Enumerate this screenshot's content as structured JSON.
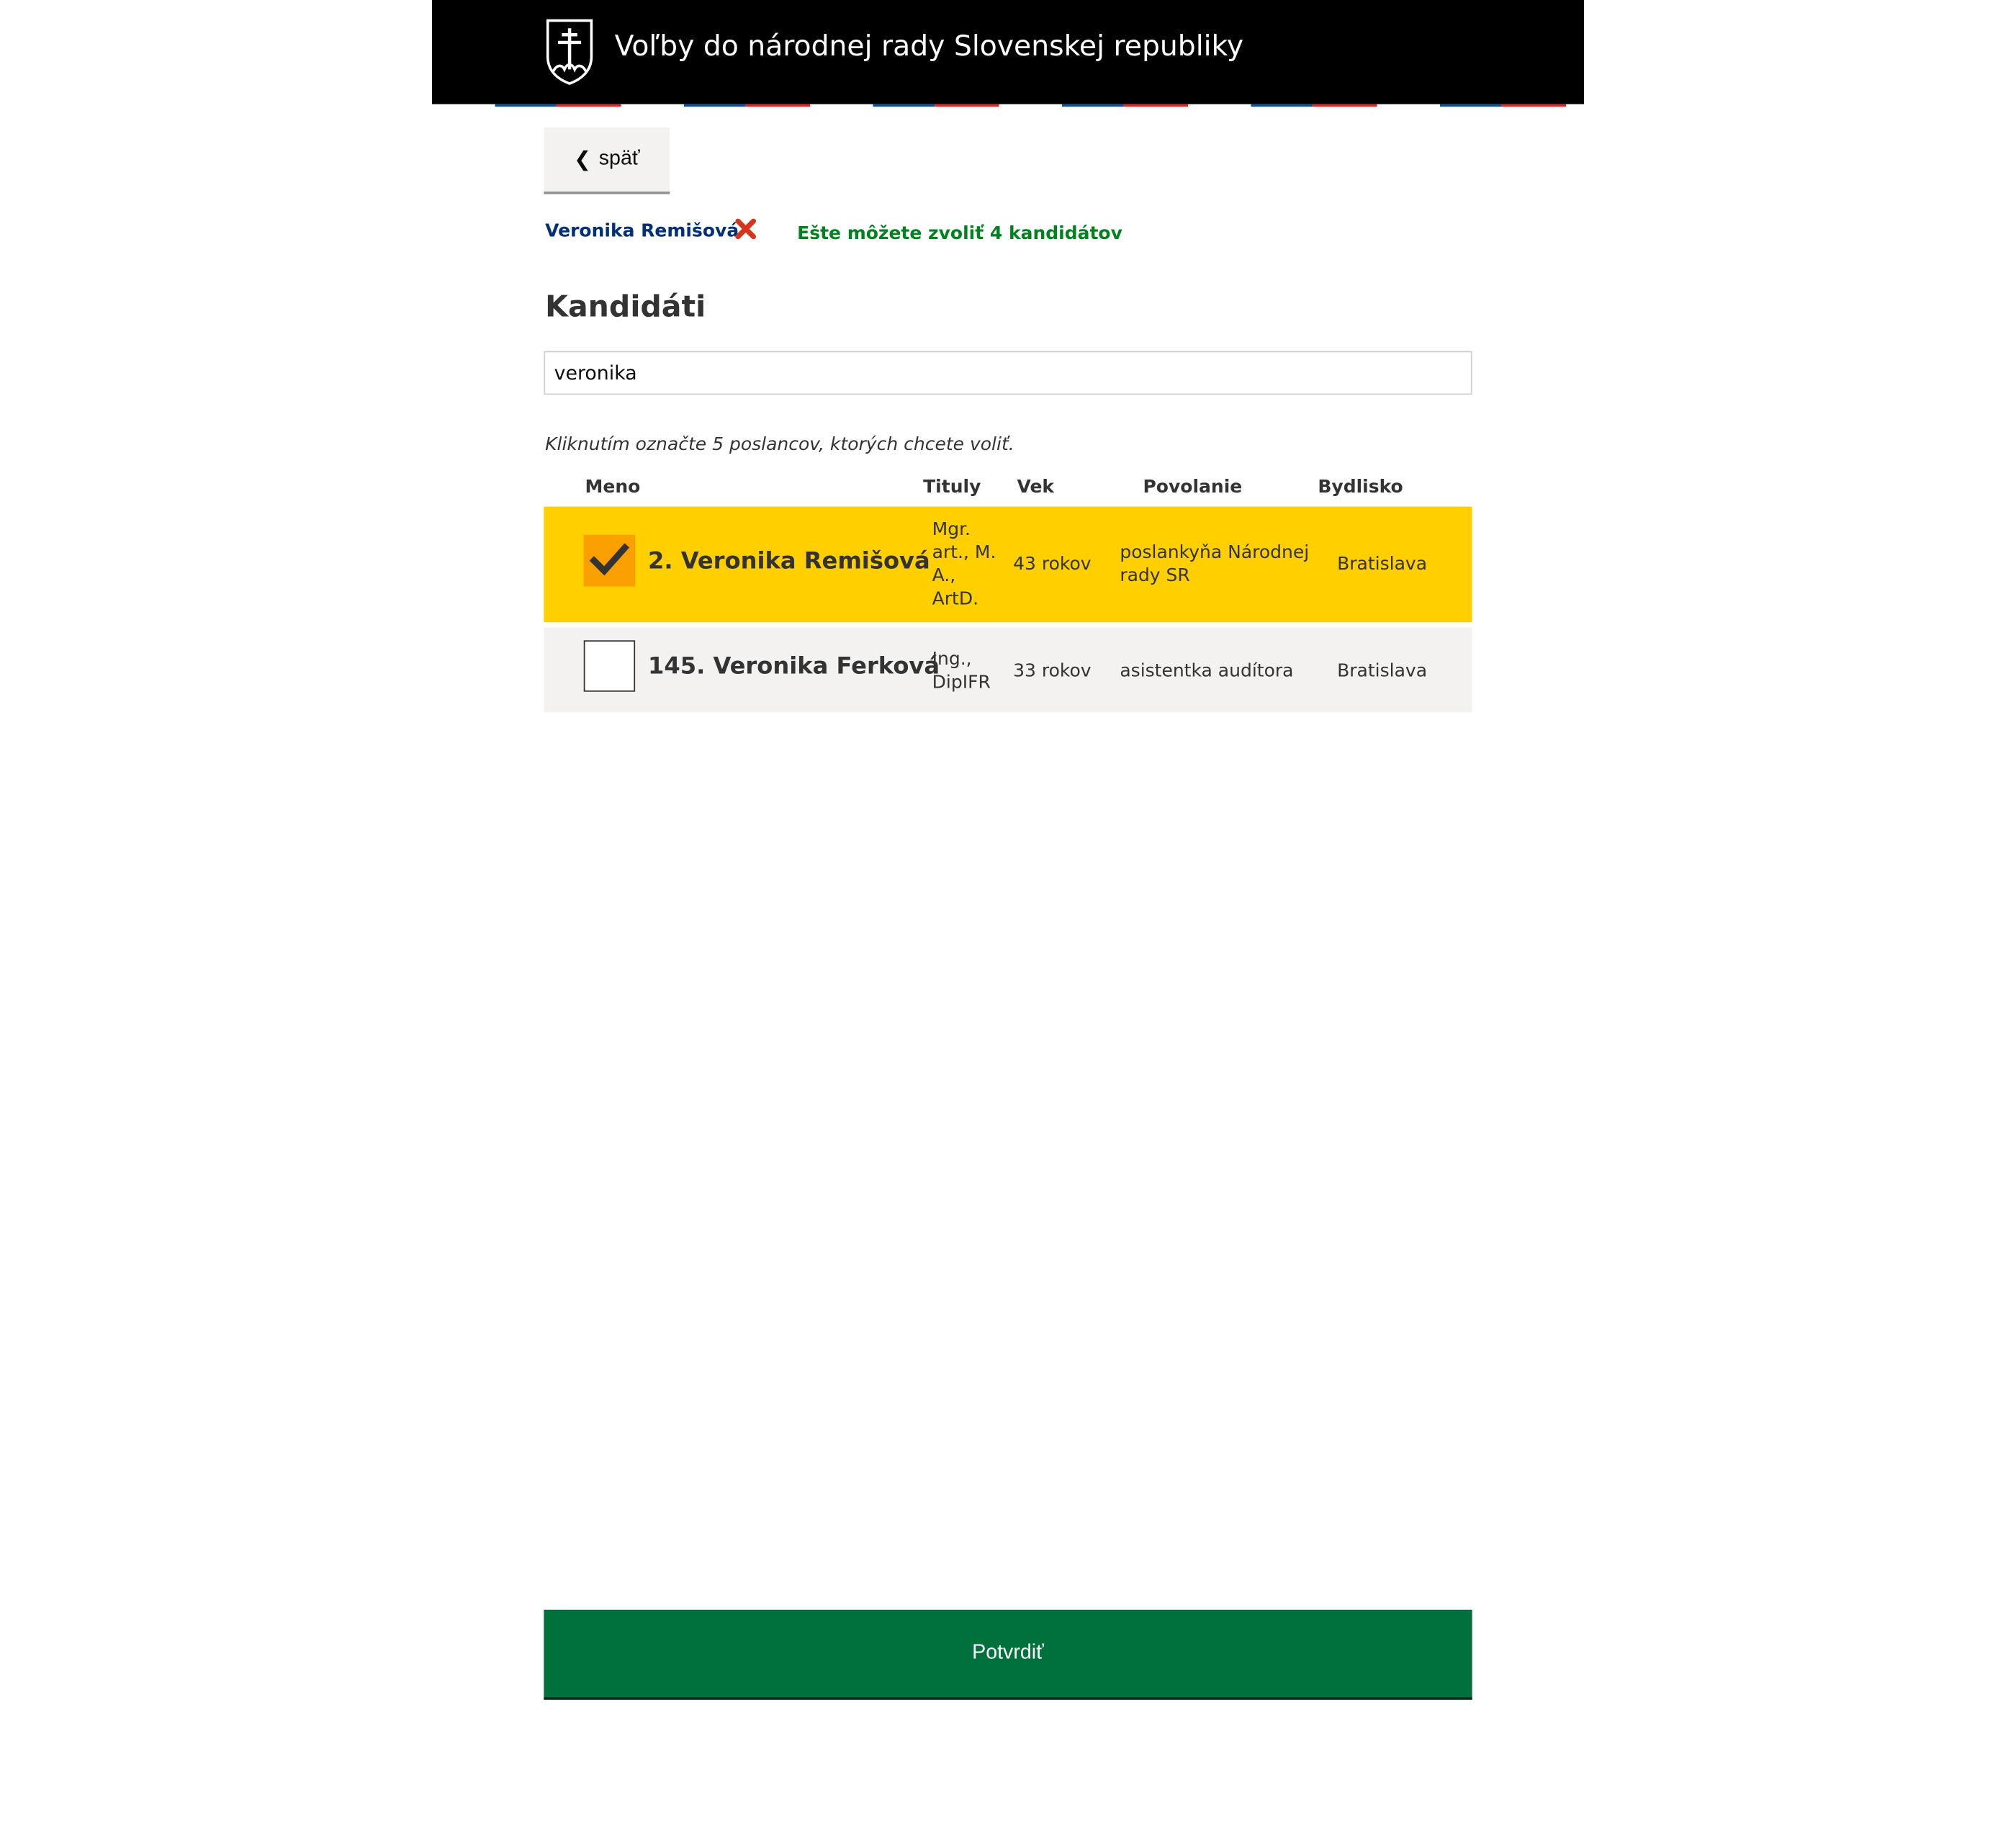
{
  "header": {
    "title": "Voľby do národnej rady Slovenskej republiky"
  },
  "nav": {
    "back_label": "späť",
    "back_icon": "❮"
  },
  "selection": {
    "selected_name": "Veronika Remišová",
    "remaining_text": "Ešte môžete zvoliť 4 kandidátov"
  },
  "candidates": {
    "heading": "Kandidáti",
    "search_value": "veronika",
    "hint": "Kliknutím označte 5 poslancov, ktorých chcete voliť.",
    "columns": {
      "name": "Meno",
      "titles": "Tituly",
      "age": "Vek",
      "occupation": "Povolanie",
      "residence": "Bydlisko"
    },
    "rows": [
      {
        "name": "2. Veronika Remišová",
        "titles": [
          "Mgr.",
          "art., M.",
          "A.,",
          "ArtD."
        ],
        "age": "43 rokov",
        "occupation": [
          "poslankyňa Národnej",
          "rady SR"
        ],
        "residence": "Bratislava",
        "checked": true
      },
      {
        "name": "145. Veronika Ferková",
        "titles": [
          "Ing.,",
          "DipIFR"
        ],
        "age": "33 rokov",
        "occupation": [
          "asistentka audítora"
        ],
        "residence": "Bratislava",
        "checked": false
      }
    ]
  },
  "footer": {
    "confirm_label": "Potvrdiť"
  },
  "colors": {
    "header_bg": "#000000",
    "flag_blue": "#0b4ea2",
    "flag_red": "#ee1c25",
    "selected_row": "#ffcf00",
    "checkbox_checked": "#f9a000",
    "confirm_bg": "#00703c",
    "remaining_text": "#00821e",
    "remove_icon": "#d4351c"
  }
}
